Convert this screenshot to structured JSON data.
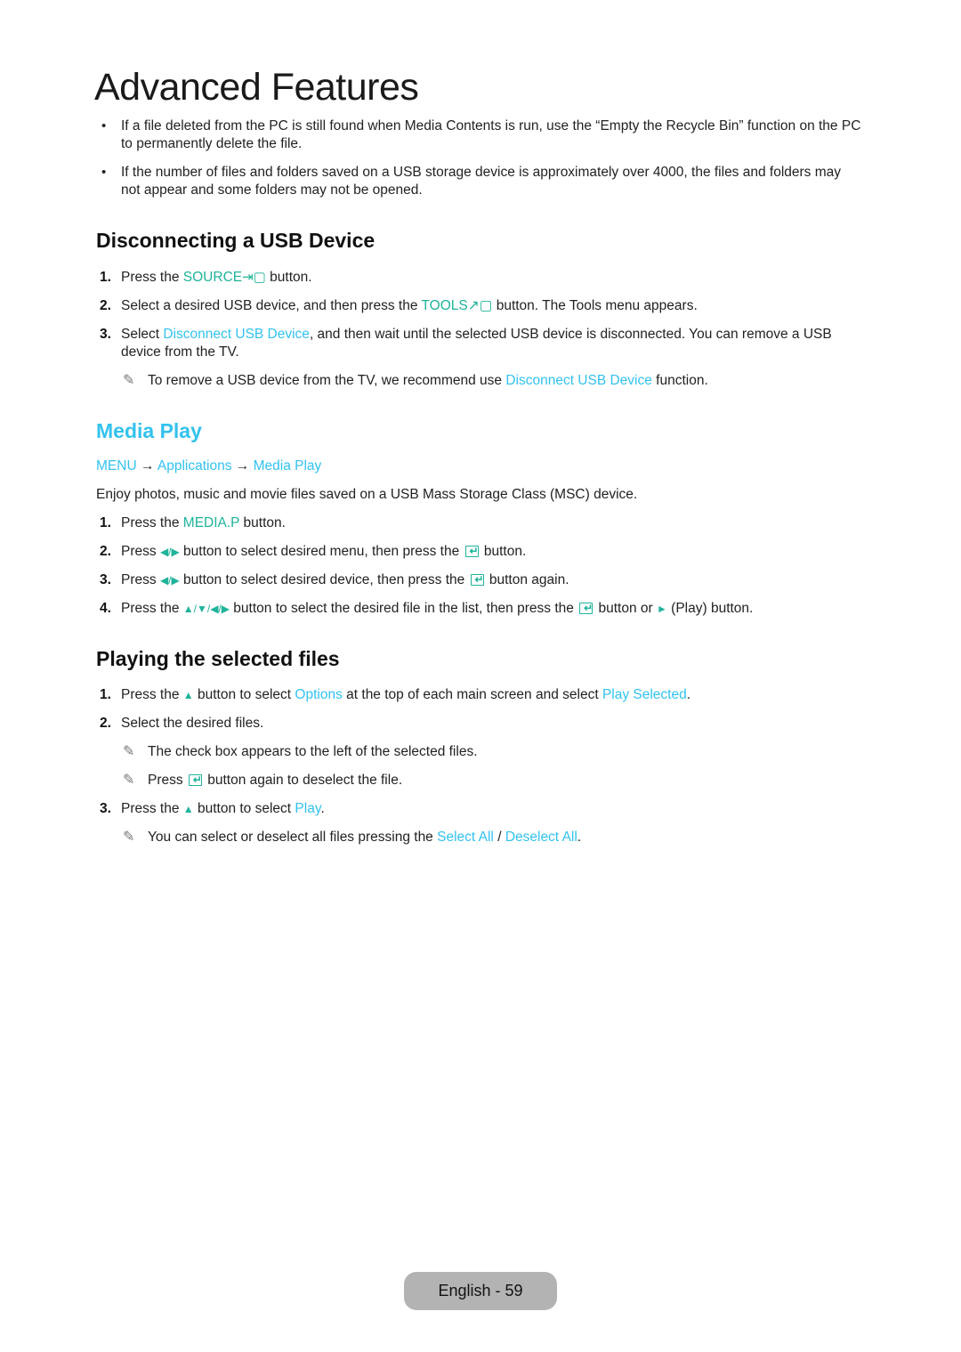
{
  "page": {
    "title": "Advanced Features",
    "footer": "English - 59"
  },
  "colors": {
    "link": "#33c2ee",
    "key": "#1fb39a",
    "footer_bg": "#b3b3b3"
  },
  "intro_bullets": [
    "If a file deleted from the PC is still found when Media Contents is run, use the “Empty the Recycle Bin” function on the PC to permanently delete the file.",
    "If the number of files and folders saved on a USB storage device is approximately over 4000, the files and folders may not appear and some folders may not be opened."
  ],
  "disconnect": {
    "heading": "Disconnecting a USB Device",
    "step1": {
      "num": "1.",
      "pre": "Press the ",
      "key": "SOURCE",
      "icon": "source-icon",
      "post": " button."
    },
    "step2": {
      "num": "2.",
      "pre": "Select a desired USB device, and then press the ",
      "key": "TOOLS",
      "icon": "tools-icon",
      "post": " button. The Tools menu appears."
    },
    "step3": {
      "num": "3.",
      "pre": "Select ",
      "link": "Disconnect USB Device",
      "post": ", and then wait until the selected USB device is disconnected. You can remove a USB device from the TV."
    },
    "note": {
      "pre": "To remove a USB device from the TV, we recommend use ",
      "link": "Disconnect USB Device",
      "post": " function."
    }
  },
  "media_play": {
    "heading": "Media Play",
    "path": {
      "menu": "MENU",
      "arrow": "→",
      "applications": "Applications",
      "media_play": "Media Play"
    },
    "description": "Enjoy photos, music and movie files saved on a USB Mass Storage Class (MSC) device.",
    "step1": {
      "num": "1.",
      "pre": "Press the ",
      "key": "MEDIA.P",
      "post": " button."
    },
    "step2": {
      "num": "2.",
      "pre": "Press ",
      "arrows": "◀/▶",
      "mid": " button to select desired menu, then press the ",
      "post": " button."
    },
    "step3": {
      "num": "3.",
      "pre": "Press ",
      "arrows": "◀/▶",
      "mid": " button to select desired device, then press the ",
      "post": " button again."
    },
    "step4": {
      "num": "4.",
      "pre": "Press the ",
      "arrows": "▲/▼/◀/▶",
      "mid": " button to select the desired file in the list, then press the ",
      "mid2": " button or ",
      "play": "►",
      "post": " (Play) button."
    }
  },
  "playing": {
    "heading": "Playing the selected files",
    "step1": {
      "num": "1.",
      "pre": "Press the ",
      "up": "▲",
      "mid": " button to select ",
      "link1": "Options",
      "mid2": " at the top of each main screen and select ",
      "link2": "Play Selected",
      "post": "."
    },
    "step2": {
      "num": "2.",
      "text": "Select the desired files."
    },
    "note1": "The check box appears to the left of the selected files.",
    "note2": {
      "pre": "Press ",
      "post": " button again to deselect the file."
    },
    "step3": {
      "num": "3.",
      "pre": "Press the ",
      "up": "▲",
      "mid": " button to select ",
      "link": "Play",
      "post": "."
    },
    "note3": {
      "pre": "You can select or deselect all files pressing the ",
      "link1": "Select All",
      "sep": " / ",
      "link2": "Deselect All",
      "post": "."
    }
  },
  "icons": {
    "note": "✎"
  }
}
